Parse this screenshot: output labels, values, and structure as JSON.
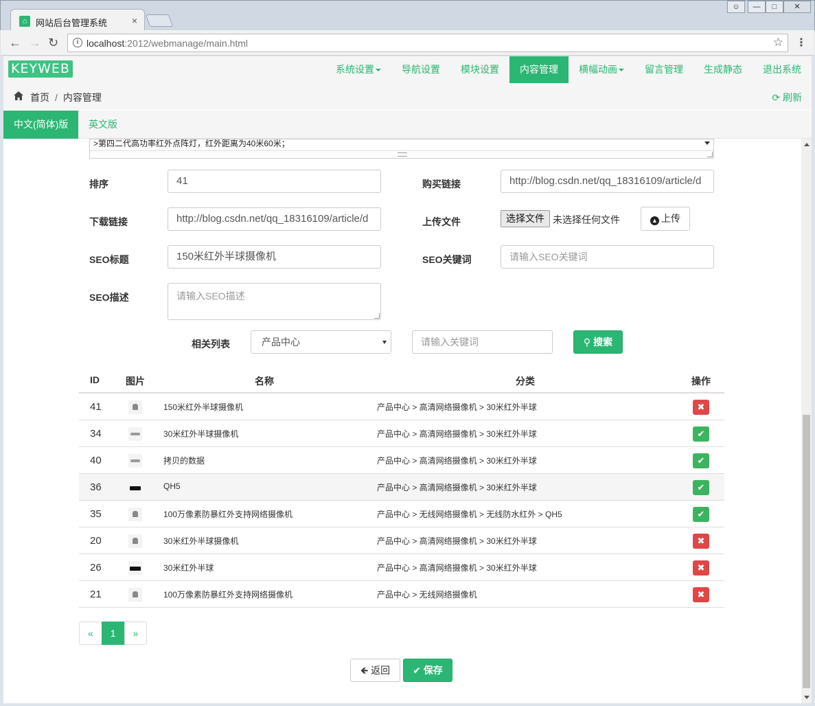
{
  "browser": {
    "tab_title": "网站后台管理系统",
    "tab_close": "×",
    "url_host": "localhost",
    "url_path": ":2012/webmanage/main.html"
  },
  "site": {
    "logo": "KEYWEB",
    "menu": [
      {
        "label": "系统设置",
        "dropdown": true
      },
      {
        "label": "导航设置",
        "dropdown": false
      },
      {
        "label": "模块设置",
        "dropdown": false
      },
      {
        "label": "内容管理",
        "dropdown": false,
        "active": true
      },
      {
        "label": "横幅动画",
        "dropdown": true
      },
      {
        "label": "留言管理",
        "dropdown": false
      },
      {
        "label": "生成静态",
        "dropdown": false
      },
      {
        "label": "退出系统",
        "dropdown": false
      }
    ],
    "accent": "#2bb673"
  },
  "breadcrumb": {
    "home": "首页",
    "separator": "/",
    "current": "内容管理",
    "refresh": "刷新"
  },
  "lang_tabs": {
    "active": "中文(简体)版",
    "inactive": "英文版"
  },
  "form": {
    "textarea_snippet": ">第四二代高功率红外点阵灯，红外距离为40米60米；",
    "sort_label": "排序",
    "sort_value": "41",
    "buy_link_label": "购买链接",
    "buy_link_value": "http://blog.csdn.net/qq_18316109/article/d",
    "download_label": "下载链接",
    "download_value": "http://blog.csdn.net/qq_18316109/article/d",
    "upload_label": "上传文件",
    "choose_file": "选择文件",
    "no_file": "未选择任何文件",
    "upload_button": "上传",
    "seo_title_label": "SEO标题",
    "seo_title_value": "150米红外半球摄像机",
    "seo_keywords_label": "SEO关键词",
    "seo_keywords_placeholder": "请输入SEO关键词",
    "seo_desc_label": "SEO描述",
    "seo_desc_placeholder": "请输入SEO描述",
    "related_label": "相关列表",
    "related_select": "产品中心",
    "keyword_placeholder": "请输入关键词",
    "search_button": "搜索"
  },
  "table": {
    "headers": {
      "id": "ID",
      "image": "图片",
      "name": "名称",
      "category": "分类",
      "action": "操作"
    },
    "rows": [
      {
        "id": "41",
        "thumb": "dome",
        "name": "150米红外半球摄像机",
        "category": "产品中心 > 高清网络摄像机 > 30米红外半球",
        "action": "remove",
        "icon": "✖"
      },
      {
        "id": "34",
        "thumb": "flat",
        "name": "30米红外半球摄像机",
        "category": "产品中心 > 高清网络摄像机 > 30米红外半球",
        "action": "add",
        "icon": "✔"
      },
      {
        "id": "40",
        "thumb": "flat",
        "name": "拷贝的数据",
        "category": "产品中心 > 高清网络摄像机 > 30米红外半球",
        "action": "add",
        "icon": "✔"
      },
      {
        "id": "36",
        "thumb": "box",
        "name": "QH5",
        "category": "产品中心 > 高清网络摄像机 > 30米红外半球",
        "action": "add",
        "icon": "✔"
      },
      {
        "id": "35",
        "thumb": "dome",
        "name": "100万像素防暴红外支持网络摄像机",
        "category": "产品中心 > 无线网络摄像机 > 无线防水红外 > QH5",
        "action": "add",
        "icon": "✔"
      },
      {
        "id": "20",
        "thumb": "dome",
        "name": "30米红外半球摄像机",
        "category": "产品中心 > 高清网络摄像机 > 30米红外半球",
        "action": "remove",
        "icon": "✖"
      },
      {
        "id": "26",
        "thumb": "box",
        "name": "30米红外半球",
        "category": "产品中心 > 高清网络摄像机 > 30米红外半球",
        "action": "remove",
        "icon": "✖"
      },
      {
        "id": "21",
        "thumb": "dome",
        "name": "100万像素防暴红外支持网络摄像机",
        "category": "产品中心 > 无线网络摄像机",
        "action": "remove",
        "icon": "✖"
      }
    ]
  },
  "pagination": {
    "prev": "«",
    "current": "1",
    "next": "»"
  },
  "actions": {
    "back": "返回",
    "save": "保存"
  }
}
